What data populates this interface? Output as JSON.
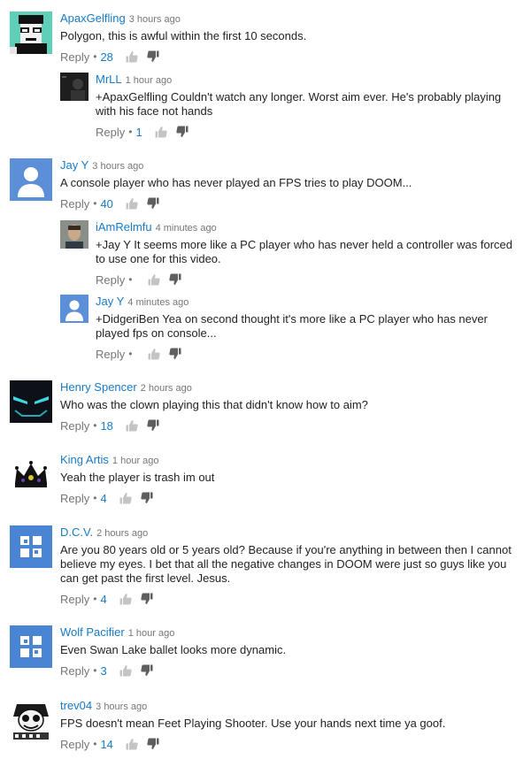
{
  "comments": [
    {
      "author": "ApaxGelfling",
      "time": "3 hours ago",
      "text": "Polygon, this is awful within the first 10 seconds.",
      "reply_label": "Reply",
      "likes": "28",
      "avatar_icon": "pixel-face-icon"
    },
    {
      "author": "MrLL",
      "time": "1 hour ago",
      "text": "+ApaxGelfling Couldn't watch any longer. Worst aim ever. He's probably playing with his face not hands",
      "reply_label": "Reply",
      "likes": "1",
      "avatar_icon": "dark-photo-icon"
    },
    {
      "author": "Jay Y",
      "time": "3 hours ago",
      "text": "A console player who has never played an FPS tries to play DOOM...",
      "reply_label": "Reply",
      "likes": "40",
      "avatar_icon": "default-user-icon"
    },
    {
      "author": "iAmRelmfu",
      "time": "4 minutes ago",
      "text": "+Jay Y It seems more like a PC player who has never held a controller was forced to use one for this video.",
      "reply_label": "Reply",
      "likes": "",
      "avatar_icon": "person-photo-icon"
    },
    {
      "author": "Jay Y",
      "time": "4 minutes ago",
      "text": "+DidgeriBen Yea on second thought it's more like a PC player who has never played fps on console...",
      "reply_label": "Reply",
      "likes": "",
      "avatar_icon": "default-user-icon"
    },
    {
      "author": "Henry Spencer",
      "time": "2 hours ago",
      "text": "Who was the clown playing this that didn't know how to aim?",
      "reply_label": "Reply",
      "likes": "18",
      "avatar_icon": "glowing-eyes-icon"
    },
    {
      "author": "King Artis",
      "time": "1 hour ago",
      "text": "Yeah the player is trash im out",
      "reply_label": "Reply",
      "likes": "4",
      "avatar_icon": "crown-icon"
    },
    {
      "author": "D.C.V.",
      "time": "2 hours ago",
      "text": "Are you 80 years old or 5 years old? Because if you're anything in between then I cannot believe my eyes. I bet that all the negative changes in DOOM were just so guys like you can get past the first level. Jesus.",
      "reply_label": "Reply",
      "likes": "4",
      "avatar_icon": "default-page-icon"
    },
    {
      "author": "Wolf Pacifier",
      "time": "1 hour ago",
      "text": "Even Swan Lake ballet looks more dynamic.",
      "reply_label": "Reply",
      "likes": "3",
      "avatar_icon": "default-page-icon"
    },
    {
      "author": "trev04",
      "time": "3 hours ago",
      "text": "FPS doesn't mean Feet Playing Shooter. Use your hands next time ya goof.",
      "reply_label": "Reply",
      "likes": "14",
      "avatar_icon": "manga-face-icon"
    }
  ],
  "colors": {
    "link": "#167ac6",
    "meta": "#767676",
    "text": "#222222",
    "default_avatar": "#5b8fd8",
    "page_avatar": "#4a85d4"
  }
}
